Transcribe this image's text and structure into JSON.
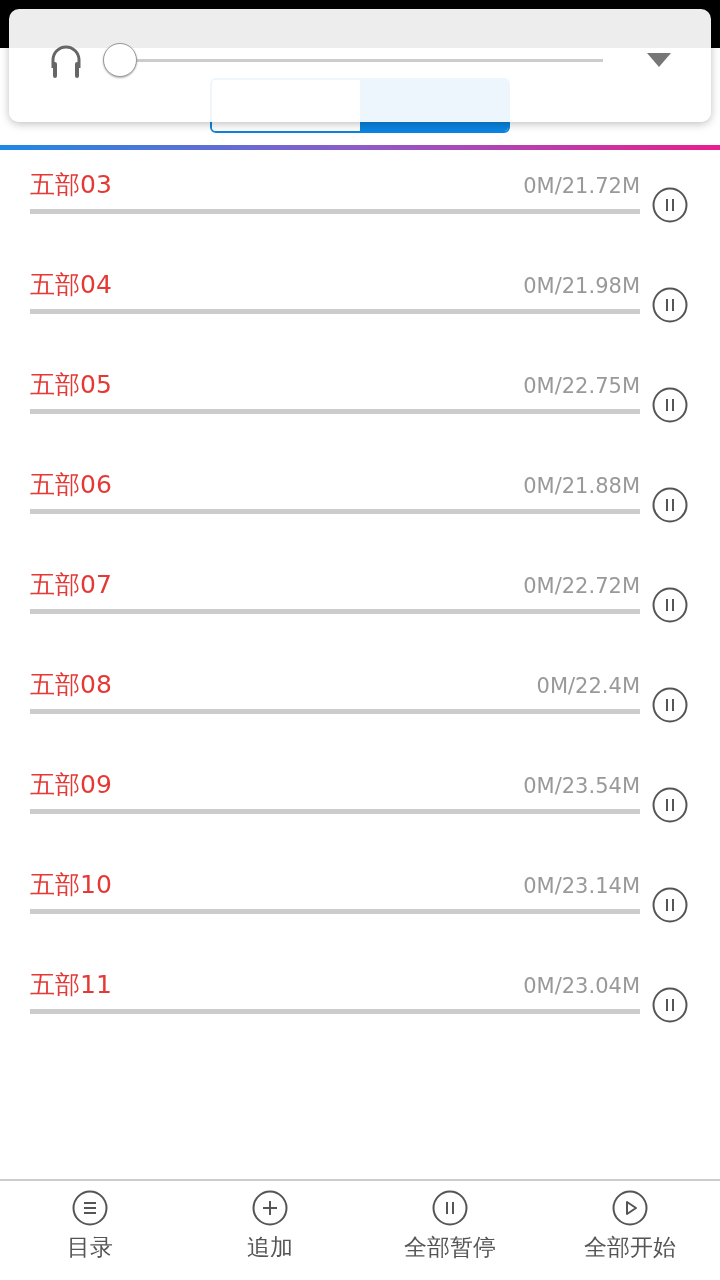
{
  "header": {
    "tabs": [
      {
        "selected": false
      },
      {
        "selected": true
      }
    ]
  },
  "player": {
    "level": 0
  },
  "downloads": [
    {
      "title": "五部03",
      "size": "0M/21.72M",
      "level": 0
    },
    {
      "title": "五部04",
      "size": "0M/21.98M",
      "level": 0
    },
    {
      "title": "五部05",
      "size": "0M/22.75M",
      "level": 0
    },
    {
      "title": "五部06",
      "size": "0M/21.88M",
      "level": 0
    },
    {
      "title": "五部07",
      "size": "0M/22.72M",
      "level": 0
    },
    {
      "title": "五部08",
      "size": "0M/22.4M",
      "level": 0
    },
    {
      "title": "五部09",
      "size": "0M/23.54M",
      "level": 0
    },
    {
      "title": "五部10",
      "size": "0M/23.14M",
      "level": 0
    },
    {
      "title": "五部11",
      "size": "0M/23.04M",
      "level": 0
    }
  ],
  "toolbar": [
    {
      "kind": "list",
      "label": "目录"
    },
    {
      "kind": "add",
      "label": "追加"
    },
    {
      "kind": "pause",
      "label": "全部暂停"
    },
    {
      "kind": "play",
      "label": "全部开始"
    }
  ]
}
